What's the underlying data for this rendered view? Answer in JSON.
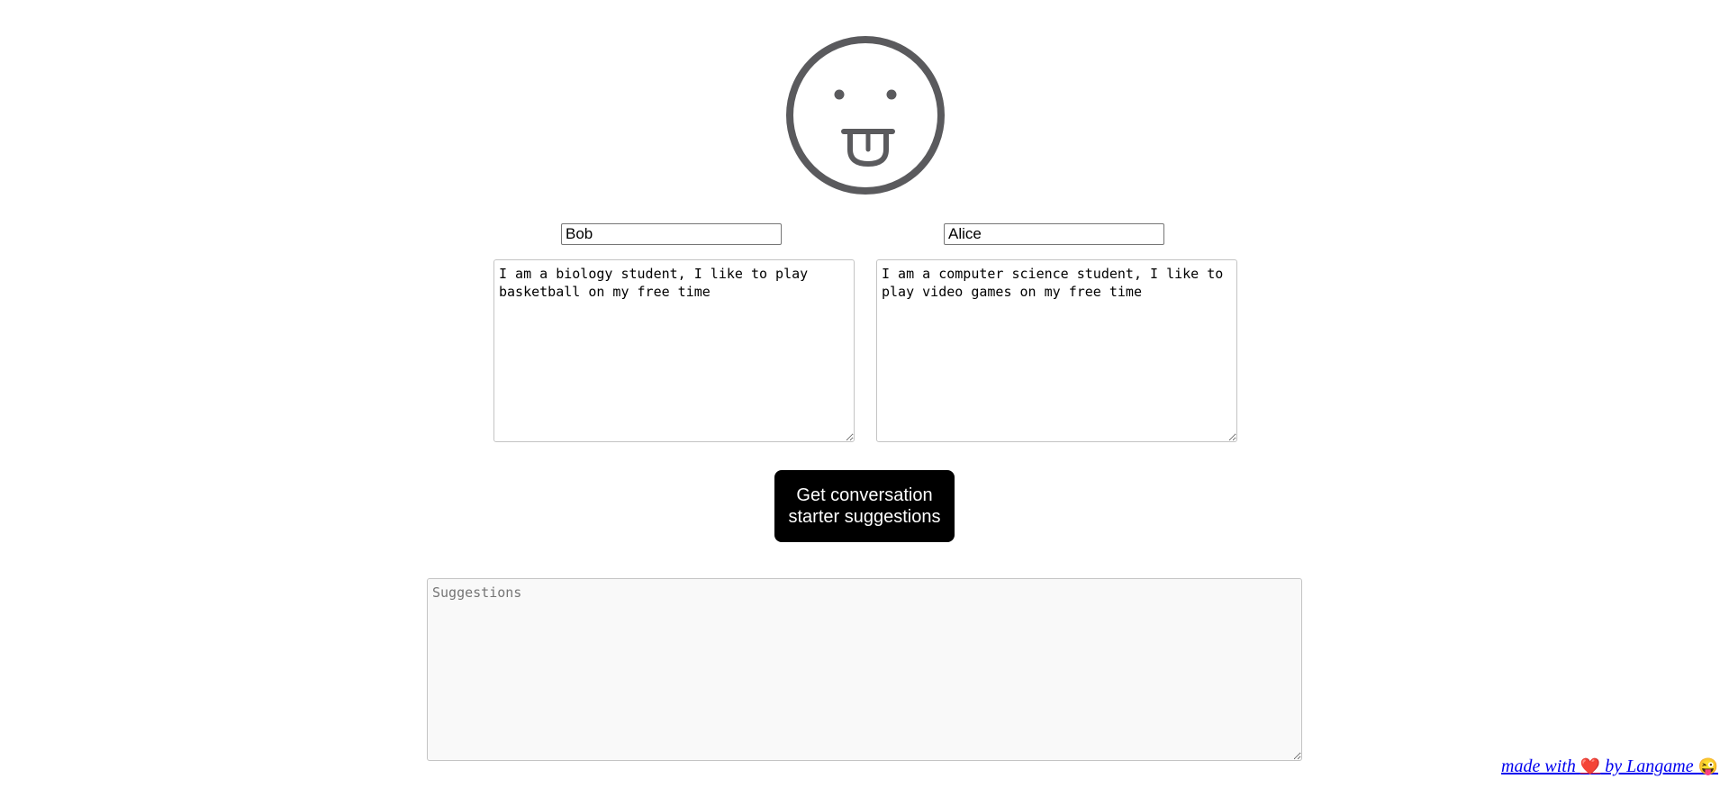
{
  "colors": {
    "logo_stroke": "#5a5a5d",
    "button_bg": "#000000",
    "button_text": "#ffffff",
    "link": "#0000ee",
    "heart": "#e0142b"
  },
  "logo": {
    "icon": "tongue-out-face-icon"
  },
  "person1": {
    "name": "Bob",
    "bio": "I am a biology student, I like to play basketball on my free time"
  },
  "person2": {
    "name": "Alice",
    "bio": "I am a computer science student, I like to play video games on my free time"
  },
  "button": {
    "label": "Get conversation starter suggestions"
  },
  "suggestions": {
    "placeholder": "Suggestions",
    "value": ""
  },
  "footer": {
    "prefix": "made with ",
    "heart": "❤️",
    "middle": " by Langame ",
    "emoji": "😜"
  }
}
